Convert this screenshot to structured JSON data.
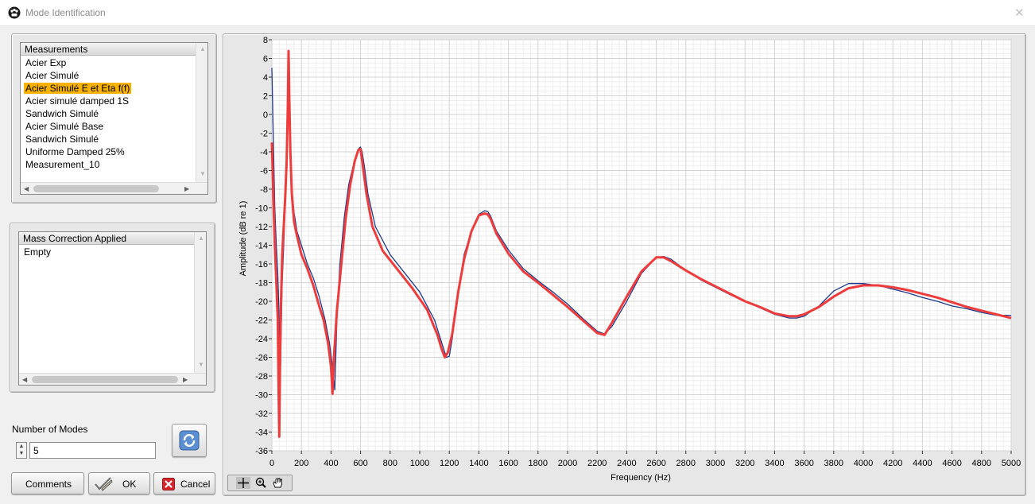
{
  "window": {
    "title": "Mode Identification",
    "close_glyph": "✕"
  },
  "measurements": {
    "header": "Measurements",
    "items": [
      "Acier Exp",
      "Acier Simulé",
      "Acier Simulé E et Eta f(f)",
      "Acier simulé damped 1S",
      "Sandwich Simulé",
      "Acier Simulé Base",
      "Sandwich Simulé",
      "Uniforme Damped 25%",
      "Measurement_10"
    ],
    "selected_index": 2
  },
  "mass_correction": {
    "header": "Mass Correction Applied",
    "items": [
      "Empty"
    ]
  },
  "modes": {
    "label": "Number of Modes",
    "value": "5"
  },
  "buttons": {
    "comments": "Comments",
    "ok": "OK",
    "cancel": "Cancel"
  },
  "icons": {
    "app": "app-icon",
    "refresh": "refresh-icon",
    "ok": "checkmark-pen-icon",
    "cancel": "cancel-x-icon",
    "cursor_tool": "crosshair-cursor-icon",
    "zoom_tool": "zoom-icon",
    "pan_tool": "pan-hand-icon"
  },
  "colors": {
    "selection": "#f9b200",
    "series_measured": "#1f3a8c",
    "series_fit": "#ee3c3c",
    "cancel_red": "#d7262b"
  },
  "chart_data": {
    "type": "line",
    "xlabel": "Frequency (Hz)",
    "ylabel": "Amplitude (dB re 1)",
    "xlim": [
      0,
      5000
    ],
    "ylim": [
      -36,
      8
    ],
    "xticks": [
      0,
      200,
      400,
      600,
      800,
      1000,
      1200,
      1400,
      1600,
      1800,
      2000,
      2200,
      2400,
      2600,
      2800,
      3000,
      3200,
      3400,
      3600,
      3800,
      4000,
      4200,
      4400,
      4600,
      4800,
      5000
    ],
    "yticks": [
      8,
      6,
      4,
      2,
      0,
      -2,
      -4,
      -6,
      -8,
      -10,
      -12,
      -14,
      -16,
      -18,
      -20,
      -22,
      -24,
      -26,
      -28,
      -30,
      -32,
      -34,
      -36
    ],
    "grid": true,
    "series": [
      {
        "color": "#1f3a8c",
        "x": [
          0,
          10,
          20,
          30,
          40,
          48,
          55,
          62,
          70,
          80,
          90,
          100,
          108,
          113,
          118,
          125,
          135,
          150,
          170,
          200,
          240,
          280,
          320,
          360,
          390,
          410,
          425,
          432,
          440,
          460,
          490,
          520,
          550,
          575,
          590,
          600,
          610,
          625,
          650,
          700,
          800,
          900,
          1000,
          1050,
          1100,
          1150,
          1180,
          1200,
          1220,
          1260,
          1300,
          1350,
          1400,
          1440,
          1460,
          1480,
          1520,
          1600,
          1700,
          1800,
          1900,
          2000,
          2100,
          2200,
          2250,
          2300,
          2400,
          2500,
          2600,
          2650,
          2700,
          2800,
          2900,
          3000,
          3100,
          3200,
          3300,
          3400,
          3500,
          3550,
          3600,
          3700,
          3800,
          3900,
          4000,
          4100,
          4200,
          4300,
          4400,
          4500,
          4600,
          4700,
          4800,
          4900,
          5000
        ],
        "y": [
          5,
          -3,
          -10,
          -14,
          -17,
          -21,
          -31,
          -24,
          -18,
          -14,
          -10,
          -4,
          1.5,
          6.5,
          3,
          -3,
          -8,
          -10.5,
          -12.5,
          -14,
          -16,
          -17.5,
          -19.5,
          -22,
          -24.5,
          -27,
          -29.5,
          -26,
          -22,
          -16,
          -11,
          -7.5,
          -5.5,
          -4.2,
          -3.6,
          -3.5,
          -4,
          -5.5,
          -8.5,
          -12,
          -15,
          -17,
          -19,
          -20.5,
          -22,
          -24.5,
          -26,
          -25.9,
          -24,
          -19,
          -15,
          -12.5,
          -10.7,
          -10.3,
          -10.4,
          -10.9,
          -12.5,
          -14.5,
          -16.5,
          -17.8,
          -19,
          -20.3,
          -21.8,
          -23.2,
          -23.5,
          -22.7,
          -20,
          -17,
          -15.3,
          -15.2,
          -15.5,
          -16.7,
          -17.7,
          -18.5,
          -19.3,
          -20,
          -20.7,
          -21.4,
          -21.8,
          -21.8,
          -21.6,
          -20.5,
          -18.9,
          -18.1,
          -18.1,
          -18.3,
          -18.7,
          -19.1,
          -19.6,
          -20,
          -20.5,
          -20.8,
          -21.2,
          -21.5,
          -21.5
        ]
      },
      {
        "color": "#ee3c3c",
        "x": [
          0,
          10,
          20,
          30,
          40,
          45,
          50,
          55,
          62,
          70,
          80,
          90,
          100,
          108,
          113,
          118,
          125,
          135,
          150,
          170,
          200,
          240,
          280,
          320,
          350,
          380,
          400,
          410,
          420,
          440,
          470,
          500,
          530,
          560,
          585,
          600,
          615,
          640,
          680,
          750,
          850,
          950,
          1050,
          1120,
          1150,
          1170,
          1190,
          1220,
          1260,
          1300,
          1350,
          1400,
          1440,
          1460,
          1480,
          1520,
          1600,
          1700,
          1800,
          1900,
          2000,
          2100,
          2200,
          2250,
          2300,
          2400,
          2500,
          2600,
          2650,
          2700,
          2800,
          2900,
          3000,
          3100,
          3200,
          3300,
          3400,
          3500,
          3550,
          3600,
          3700,
          3800,
          3900,
          4000,
          4100,
          4200,
          4300,
          4400,
          4500,
          4600,
          4700,
          4800,
          4900,
          5000
        ],
        "y": [
          -3,
          -9,
          -14,
          -18,
          -22,
          -29,
          -34.5,
          -27,
          -20,
          -15,
          -12,
          -9,
          -5,
          1,
          6.8,
          2,
          -4,
          -8.5,
          -11.5,
          -13,
          -15,
          -16.5,
          -18.3,
          -20.5,
          -22,
          -24.5,
          -27,
          -29.9,
          -26,
          -21,
          -16,
          -11,
          -7.5,
          -5,
          -3.8,
          -3.7,
          -5.5,
          -8.5,
          -12,
          -14.6,
          -16.6,
          -18.6,
          -20.9,
          -23.6,
          -25.2,
          -26,
          -25.5,
          -23.5,
          -19,
          -15.5,
          -12.5,
          -10.8,
          -10.6,
          -10.7,
          -11.2,
          -12.8,
          -14.9,
          -16.8,
          -18,
          -19.3,
          -20.6,
          -22,
          -23.4,
          -23.6,
          -22.3,
          -19.5,
          -16.8,
          -15.3,
          -15.3,
          -15.7,
          -16.7,
          -17.6,
          -18.4,
          -19.2,
          -20,
          -20.6,
          -21.3,
          -21.6,
          -21.6,
          -21.4,
          -20.6,
          -19.5,
          -18.6,
          -18.3,
          -18.3,
          -18.5,
          -18.8,
          -19.2,
          -19.6,
          -20.1,
          -20.6,
          -21,
          -21.4,
          -21.8
        ]
      }
    ]
  }
}
